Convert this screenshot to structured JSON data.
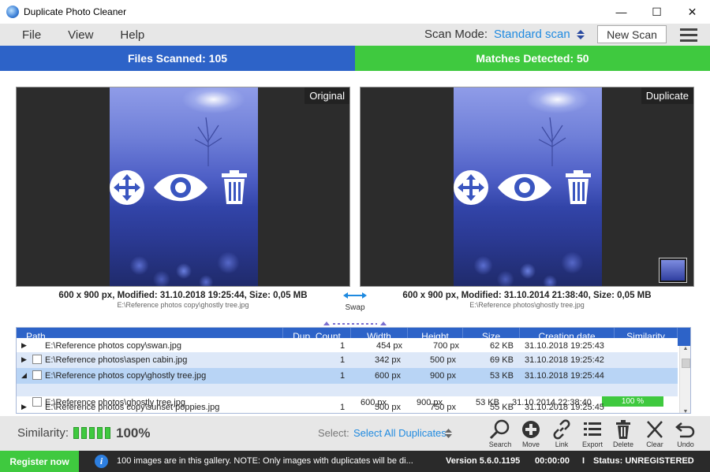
{
  "window": {
    "title": "Duplicate Photo Cleaner",
    "minimize": "—",
    "maximize": "☐",
    "close": "✕"
  },
  "menu": [
    "File",
    "View",
    "Help"
  ],
  "scan_mode": {
    "label": "Scan Mode:",
    "value": "Standard scan",
    "new_scan": "New Scan"
  },
  "stats": {
    "files_scanned": "Files Scanned: 105",
    "matches_detected": "Matches Detected: 50"
  },
  "preview": {
    "left": {
      "tag": "Original",
      "info": "600 x 900 px, Modified: 31.10.2018 19:25:44, Size: 0,05 MB",
      "path": "E:\\Reference photos copy\\ghostly tree.jpg"
    },
    "right": {
      "tag": "Duplicate",
      "info": "600 x 900 px, Modified: 31.10.2014 21:38:40, Size: 0,05 MB",
      "path": "E:\\Reference photos\\ghostly tree.jpg"
    },
    "swap": "Swap",
    "overlay_icons": [
      "move-icon",
      "eye-icon",
      "trash-icon"
    ]
  },
  "table": {
    "columns": [
      "Path",
      "Dup. Count",
      "Width",
      "Height",
      "Size",
      "Creation date",
      "Similarity"
    ],
    "rows": [
      {
        "path": "E:\\Reference photos copy\\swan.jpg",
        "dup": "1",
        "width": "454 px",
        "height": "700 px",
        "size": "62 KB",
        "date": "31.10.2018 19:25:43",
        "state": "cut"
      },
      {
        "path": "E:\\Reference photos\\aspen cabin.jpg",
        "dup": "1",
        "width": "342 px",
        "height": "500 px",
        "size": "69 KB",
        "date": "31.10.2018 19:25:42",
        "state": "alt"
      },
      {
        "path": "E:\\Reference photos copy\\ghostly tree.jpg",
        "dup": "1",
        "width": "600 px",
        "height": "900 px",
        "size": "53 KB",
        "date": "31.10.2018 19:25:44",
        "state": "selected"
      },
      {
        "path": "E:\\Reference photos\\ghostly tree.jpg",
        "dup": "",
        "width": "600 px",
        "height": "900 px",
        "size": "53 KB",
        "date": "31.10.2014 22:38:40",
        "similarity": "100 %",
        "state": "child"
      },
      {
        "path": "E:\\Reference photos copy\\sunset poppies.jpg",
        "dup": "1",
        "width": "500 px",
        "height": "750 px",
        "size": "55 KB",
        "date": "31.10.2018 19:25:45",
        "state": "normal"
      }
    ]
  },
  "bottom": {
    "similarity_label": "Similarity:",
    "similarity_value": "100%",
    "select_label": "Select:",
    "select_value": "Select All Duplicates",
    "tools": [
      "Search",
      "Move",
      "Link",
      "Export",
      "Delete",
      "Clear",
      "Undo"
    ]
  },
  "status": {
    "register": "Register now",
    "message": "100 images are in this gallery. NOTE: Only images with duplicates will be di...",
    "version": "Version 5.6.0.1195",
    "time": "00:00:00",
    "separator": "I",
    "status": "Status: UNREGISTERED"
  },
  "colors": {
    "accent_blue": "#2d63c8",
    "accent_green": "#3fc93f",
    "link_blue": "#1f8ae0",
    "selected_row": "#b8d4f5",
    "alt_row": "#dde8f8"
  }
}
